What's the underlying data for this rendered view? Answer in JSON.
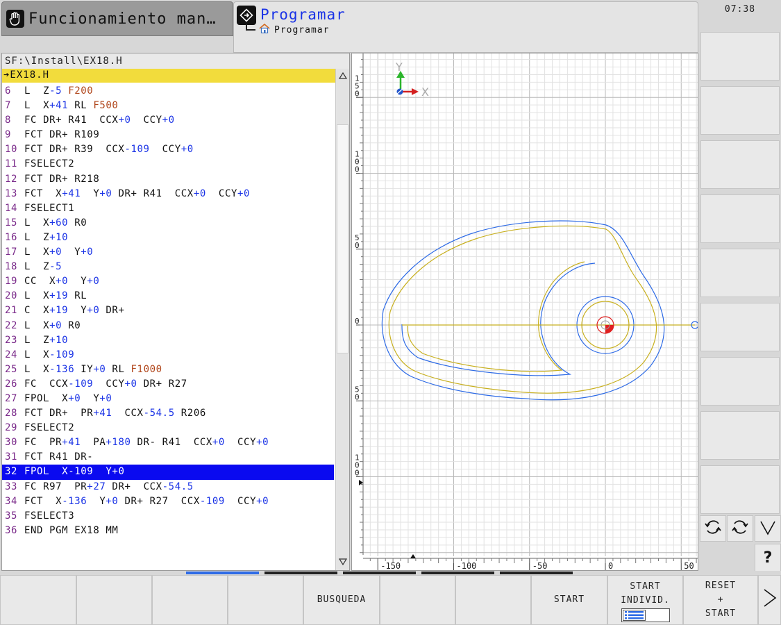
{
  "header": {
    "mode_manual": "Funcionamiento man…",
    "mode_program": "Programar",
    "mode_program_sub": "Programar",
    "time": "07:38"
  },
  "program": {
    "path": "SF:\\Install\\EX18.H",
    "file_header": "➔EX18.H",
    "lines": [
      {
        "n": "6",
        "parts": [
          [
            "L  Z",
            ""
          ],
          [
            "-5",
            "b"
          ],
          [
            " ",
            ""
          ],
          [
            "F200",
            "o"
          ]
        ]
      },
      {
        "n": "7",
        "parts": [
          [
            "L  X",
            ""
          ],
          [
            "+41",
            "b"
          ],
          [
            " RL ",
            ""
          ],
          [
            "F500",
            "o"
          ]
        ]
      },
      {
        "n": "8",
        "parts": [
          [
            "FC DR+ R41  CCX",
            ""
          ],
          [
            "+0",
            "b"
          ],
          [
            "  CCY",
            ""
          ],
          [
            "+0",
            "b"
          ]
        ]
      },
      {
        "n": "9",
        "parts": [
          [
            "FCT DR+ R109",
            ""
          ]
        ]
      },
      {
        "n": "10",
        "parts": [
          [
            "FCT DR+ R39  CCX",
            ""
          ],
          [
            "-109",
            "b"
          ],
          [
            "  CCY",
            ""
          ],
          [
            "+0",
            "b"
          ]
        ]
      },
      {
        "n": "11",
        "parts": [
          [
            "FSELECT2",
            ""
          ]
        ]
      },
      {
        "n": "12",
        "parts": [
          [
            "FCT DR+ R218",
            ""
          ]
        ]
      },
      {
        "n": "13",
        "parts": [
          [
            "FCT  X",
            ""
          ],
          [
            "+41",
            "b"
          ],
          [
            "  Y",
            ""
          ],
          [
            "+0",
            "b"
          ],
          [
            " DR+ R41  CCX",
            ""
          ],
          [
            "+0",
            "b"
          ],
          [
            "  CCY",
            ""
          ],
          [
            "+0",
            "b"
          ]
        ]
      },
      {
        "n": "14",
        "parts": [
          [
            "FSELECT1",
            ""
          ]
        ]
      },
      {
        "n": "15",
        "parts": [
          [
            "L  X",
            ""
          ],
          [
            "+60",
            "b"
          ],
          [
            " R0",
            ""
          ]
        ]
      },
      {
        "n": "16",
        "parts": [
          [
            "L  Z",
            ""
          ],
          [
            "+10",
            "b"
          ]
        ]
      },
      {
        "n": "17",
        "parts": [
          [
            "L  X",
            ""
          ],
          [
            "+0",
            "b"
          ],
          [
            "  Y",
            ""
          ],
          [
            "+0",
            "b"
          ]
        ]
      },
      {
        "n": "18",
        "parts": [
          [
            "L  Z",
            ""
          ],
          [
            "-5",
            "b"
          ]
        ]
      },
      {
        "n": "19",
        "parts": [
          [
            "CC  X",
            ""
          ],
          [
            "+0",
            "b"
          ],
          [
            "  Y",
            ""
          ],
          [
            "+0",
            "b"
          ]
        ]
      },
      {
        "n": "20",
        "parts": [
          [
            "L  X",
            ""
          ],
          [
            "+19",
            "b"
          ],
          [
            " RL",
            ""
          ]
        ]
      },
      {
        "n": "21",
        "parts": [
          [
            "C  X",
            ""
          ],
          [
            "+19",
            "b"
          ],
          [
            "  Y",
            ""
          ],
          [
            "+0",
            "b"
          ],
          [
            " DR+",
            ""
          ]
        ]
      },
      {
        "n": "22",
        "parts": [
          [
            "L  X",
            ""
          ],
          [
            "+0",
            "b"
          ],
          [
            " R0",
            ""
          ]
        ]
      },
      {
        "n": "23",
        "parts": [
          [
            "L  Z",
            ""
          ],
          [
            "+10",
            "b"
          ]
        ]
      },
      {
        "n": "24",
        "parts": [
          [
            "L  X",
            ""
          ],
          [
            "-109",
            "b"
          ]
        ]
      },
      {
        "n": "25",
        "parts": [
          [
            "L  X",
            ""
          ],
          [
            "-136",
            "b"
          ],
          [
            " IY",
            ""
          ],
          [
            "+0",
            "b"
          ],
          [
            " RL ",
            ""
          ],
          [
            "F1000",
            "o"
          ]
        ]
      },
      {
        "n": "26",
        "parts": [
          [
            "FC  CCX",
            ""
          ],
          [
            "-109",
            "b"
          ],
          [
            "  CCY",
            ""
          ],
          [
            "+0",
            "b"
          ],
          [
            " DR+ R27",
            ""
          ]
        ]
      },
      {
        "n": "27",
        "parts": [
          [
            "FPOL  X",
            ""
          ],
          [
            "+0",
            "b"
          ],
          [
            "  Y",
            ""
          ],
          [
            "+0",
            "b"
          ]
        ]
      },
      {
        "n": "28",
        "parts": [
          [
            "FCT DR+  PR",
            ""
          ],
          [
            "+41",
            "b"
          ],
          [
            "  CCX",
            ""
          ],
          [
            "-54.5",
            "b"
          ],
          [
            " R206",
            ""
          ]
        ]
      },
      {
        "n": "29",
        "parts": [
          [
            "FSELECT2",
            ""
          ]
        ]
      },
      {
        "n": "30",
        "parts": [
          [
            "FC  PR",
            ""
          ],
          [
            "+41",
            "b"
          ],
          [
            "  PA",
            ""
          ],
          [
            "+180",
            "b"
          ],
          [
            " DR- R41  CCX",
            ""
          ],
          [
            "+0",
            "b"
          ],
          [
            "  CCY",
            ""
          ],
          [
            "+0",
            "b"
          ]
        ]
      },
      {
        "n": "31",
        "parts": [
          [
            "FCT R41 DR-",
            ""
          ]
        ]
      },
      {
        "n": "32",
        "sel": true,
        "parts": [
          [
            "FPOL  X",
            ""
          ],
          [
            "-109",
            "b"
          ],
          [
            "  Y",
            ""
          ],
          [
            "+0",
            "b"
          ]
        ]
      },
      {
        "n": "33",
        "parts": [
          [
            "FC R97  PR",
            ""
          ],
          [
            "+27",
            "b"
          ],
          [
            " DR+  CCX",
            ""
          ],
          [
            "-54.5",
            "b"
          ]
        ]
      },
      {
        "n": "34",
        "parts": [
          [
            "FCT  X",
            ""
          ],
          [
            "-136",
            "b"
          ],
          [
            "  Y",
            ""
          ],
          [
            "+0",
            "b"
          ],
          [
            " DR+ R27  CCX",
            ""
          ],
          [
            "-109",
            "b"
          ],
          [
            "  CCY",
            ""
          ],
          [
            "+0",
            "b"
          ]
        ]
      },
      {
        "n": "35",
        "parts": [
          [
            "FSELECT3",
            ""
          ]
        ]
      },
      {
        "n": "36",
        "parts": [
          [
            "END PGM EX18 MM",
            ""
          ]
        ]
      }
    ]
  },
  "graphics": {
    "axis_y_label": "Y",
    "axis_x_label": "X",
    "y_ticks": [
      "150",
      "100",
      "50",
      "0",
      "-50",
      "-100"
    ],
    "x_ticks": [
      "-150",
      "-100",
      "-50",
      "0",
      "50"
    ],
    "colors": {
      "contour": "#2e6be6",
      "tool_path": "#c8b020",
      "grid": "#d4d4d4",
      "tool": "#e02020"
    }
  },
  "softkeys": {
    "busqueda": "BUSQUEDA",
    "start": "START",
    "start_individ_1": "START",
    "start_individ_2": "INDIVID.",
    "reset_1": "RESET",
    "reset_2": "+",
    "reset_3": "START",
    "more": ">",
    "help": "?"
  },
  "icons": [
    "hand-icon",
    "program-icon",
    "home-icon",
    "rotate-left-icon",
    "rotate-right-icon",
    "chevron-down-icon",
    "chevron-right-icon"
  ]
}
